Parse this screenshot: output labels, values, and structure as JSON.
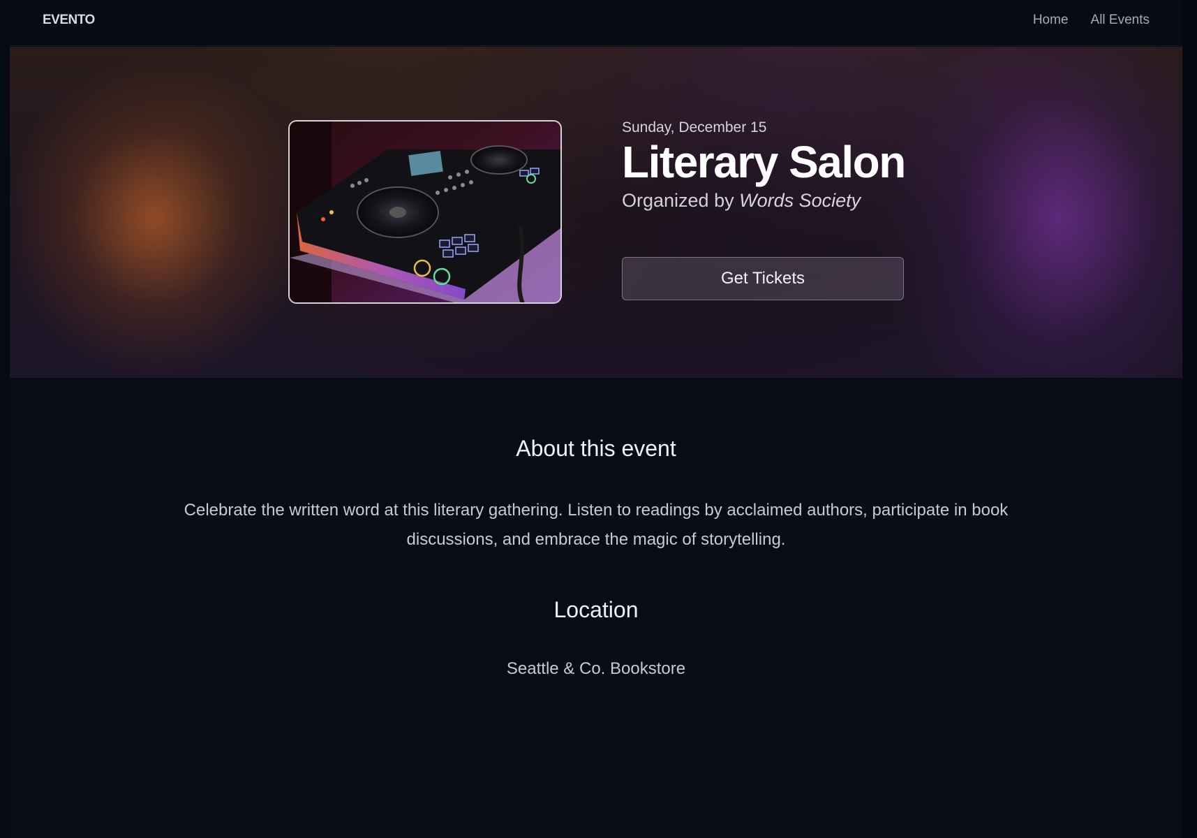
{
  "header": {
    "logo": "EVENTO",
    "nav": [
      "Home",
      "All Events"
    ]
  },
  "event": {
    "date": "Sunday, December 15",
    "title": "Literary Salon",
    "organized_by_prefix": "Organized by",
    "organizer": "Words Society",
    "cta_label": "Get Tickets"
  },
  "about": {
    "heading": "About this event",
    "text": "Celebrate the written word at this literary gathering. Listen to readings by acclaimed authors, participate in book discussions, and embrace the magic of storytelling."
  },
  "location": {
    "heading": "Location",
    "venue": "Seattle & Co. Bookstore"
  },
  "colors": {
    "background": "#080c17",
    "header": "#070b14",
    "hero_orange_glow": "#a85628",
    "hero_purple_glow": "#7832a0",
    "button_bg": "#5a5062"
  },
  "hero_image": {
    "description_icon": "dj-controller-photo"
  }
}
